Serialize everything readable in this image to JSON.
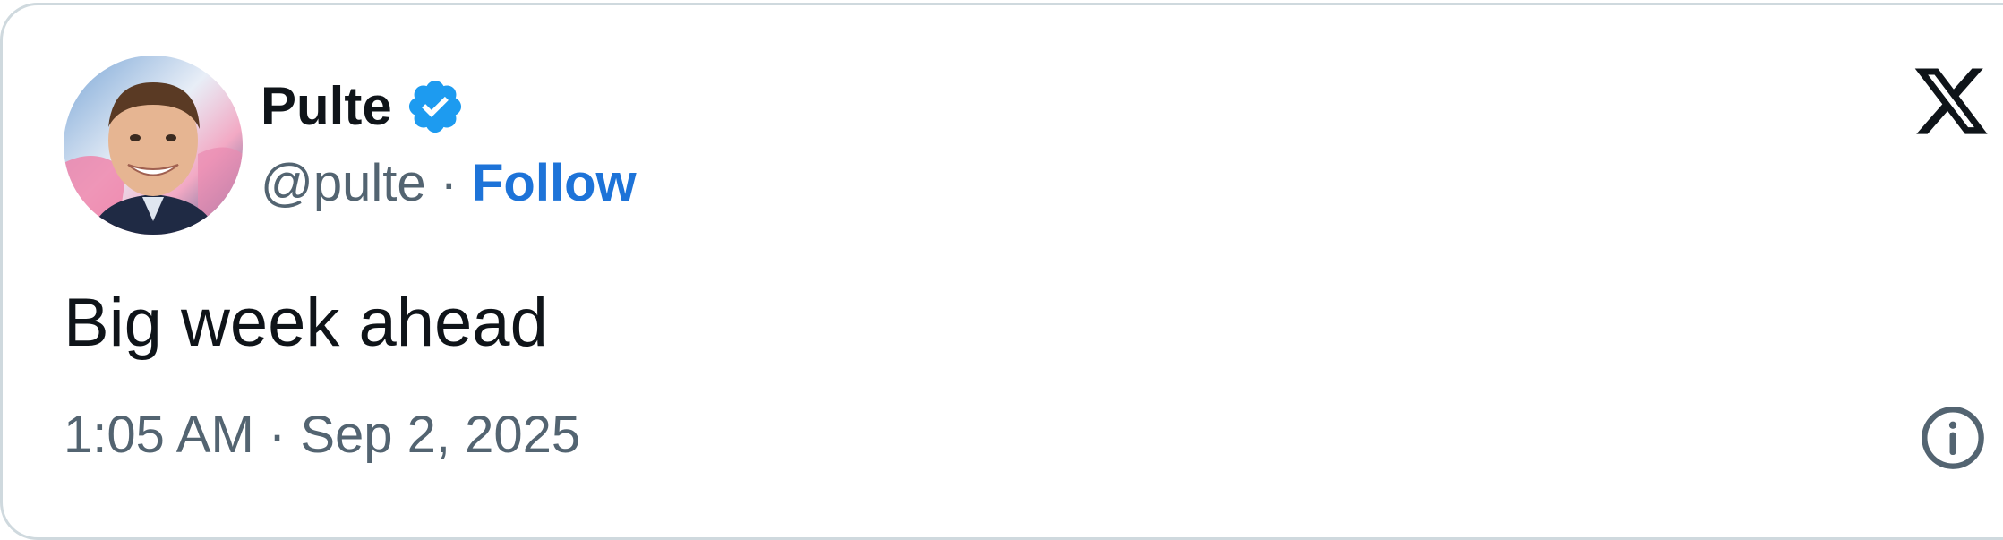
{
  "author": {
    "display_name": "Pulte",
    "handle": "@pulte",
    "separator": "·",
    "follow_label": "Follow",
    "verified": true,
    "verified_color": "#1d9bf0"
  },
  "tweet": {
    "text": "Big week ahead",
    "timestamp": "1:05 AM · Sep 2, 2025"
  },
  "icons": {
    "brand": "x-logo-icon",
    "verified": "verified-badge-icon",
    "info": "info-icon"
  },
  "colors": {
    "text_primary": "#0f1419",
    "text_secondary": "#536471",
    "link": "#1d73d8",
    "border": "#cfd9de"
  }
}
